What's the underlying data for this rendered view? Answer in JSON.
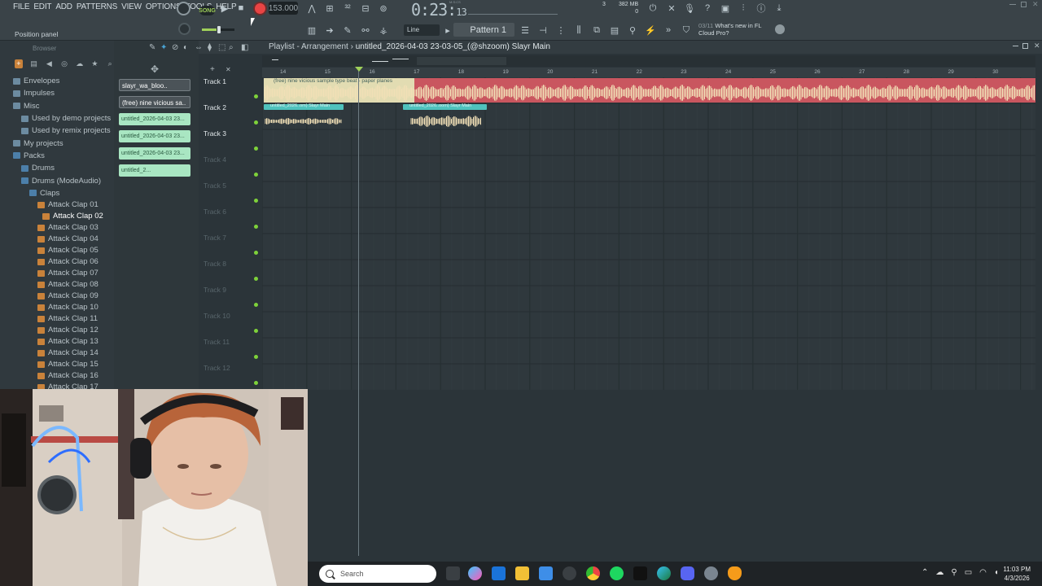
{
  "menu": [
    "FILE",
    "EDIT",
    "ADD",
    "PATTERNS",
    "VIEW",
    "OPTIONS",
    "TOOLS",
    "HELP"
  ],
  "hint": "Position panel",
  "transport": {
    "mode_label": "SONG",
    "tempo": "153.000",
    "time_main": "0:23:",
    "time_sub": "13",
    "time_unit": "M:S:CS"
  },
  "cpu": {
    "value": "3",
    "memory": "382 MB",
    "voices": "0"
  },
  "snap": "Line",
  "pattern": "Pattern 1",
  "news": {
    "date": "03/11",
    "line1": "What's new in FL",
    "line2": "Cloud Pro?"
  },
  "browser": {
    "title": "Browser",
    "items": [
      {
        "label": "Envelopes",
        "indent": 0,
        "icon": "folder"
      },
      {
        "label": "Impulses",
        "indent": 0,
        "icon": "folder"
      },
      {
        "label": "Misc",
        "indent": 0,
        "icon": "folder"
      },
      {
        "label": "Used by demo projects",
        "indent": 1,
        "icon": "folder"
      },
      {
        "label": "Used by remix projects",
        "indent": 1,
        "icon": "folder"
      },
      {
        "label": "My projects",
        "indent": 0,
        "icon": "folder"
      },
      {
        "label": "Packs",
        "indent": 0,
        "icon": "folder-open"
      },
      {
        "label": "Drums",
        "indent": 1,
        "icon": "folder-open"
      },
      {
        "label": "Drums (ModeAudio)",
        "indent": 1,
        "icon": "folder-open"
      },
      {
        "label": "Claps",
        "indent": 2,
        "icon": "folder-open"
      },
      {
        "label": "Attack Clap 01",
        "indent": 3,
        "icon": "audio"
      },
      {
        "label": "Attack Clap 02",
        "indent": 3,
        "icon": "audio",
        "selected": true
      },
      {
        "label": "Attack Clap 03",
        "indent": 3,
        "icon": "audio"
      },
      {
        "label": "Attack Clap 04",
        "indent": 3,
        "icon": "audio"
      },
      {
        "label": "Attack Clap 05",
        "indent": 3,
        "icon": "audio"
      },
      {
        "label": "Attack Clap 06",
        "indent": 3,
        "icon": "audio"
      },
      {
        "label": "Attack Clap 07",
        "indent": 3,
        "icon": "audio"
      },
      {
        "label": "Attack Clap 08",
        "indent": 3,
        "icon": "audio"
      },
      {
        "label": "Attack Clap 09",
        "indent": 3,
        "icon": "audio"
      },
      {
        "label": "Attack Clap 10",
        "indent": 3,
        "icon": "audio"
      },
      {
        "label": "Attack Clap 11",
        "indent": 3,
        "icon": "audio"
      },
      {
        "label": "Attack Clap 12",
        "indent": 3,
        "icon": "audio"
      },
      {
        "label": "Attack Clap 13",
        "indent": 3,
        "icon": "audio"
      },
      {
        "label": "Attack Clap 14",
        "indent": 3,
        "icon": "audio"
      },
      {
        "label": "Attack Clap 15",
        "indent": 3,
        "icon": "audio"
      },
      {
        "label": "Attack Clap 16",
        "indent": 3,
        "icon": "audio"
      },
      {
        "label": "Attack Clap 17",
        "indent": 3,
        "icon": "audio"
      }
    ]
  },
  "clip_list": [
    {
      "label": "slayr_wa_bloo..",
      "style": "dark"
    },
    {
      "label": "(free) nine vicious sa..",
      "style": "dark"
    },
    {
      "label": "untitled_2026-04-03 23...",
      "style": "light"
    },
    {
      "label": "untitled_2026-04-03 23...",
      "style": "light"
    },
    {
      "label": "untitled_2026-04-03 23...",
      "style": "light"
    },
    {
      "label": "untitled_2...",
      "style": "light"
    }
  ],
  "playlist": {
    "title_prefix": "Playlist - Arrangement",
    "title_project": "untitled_2026-04-03 23-03-05_(@shzoom) Slayr Main",
    "ruler": [
      "14",
      "15",
      "16",
      "17",
      "18",
      "19",
      "20",
      "21",
      "22",
      "23",
      "24",
      "25",
      "26",
      "27",
      "28",
      "29",
      "30"
    ],
    "tracks": [
      "Track 1",
      "Track 2",
      "Track 3",
      "Track 4",
      "Track 5",
      "Track 6",
      "Track 7",
      "Track 8",
      "Track 9",
      "Track 10",
      "Track 11",
      "Track 12"
    ],
    "clip1_label": "(free) nine vicious sample type beat - paper planes",
    "clip2_label": "untitled_2026..om) Slayr Main",
    "clip3_label": "untitled_2026..oom) Slayr Main"
  },
  "taskbar": {
    "search_placeholder": "Search",
    "time": "11:03 PM",
    "date": "4/3/2026"
  },
  "colors": {
    "accent_green": "#9fd05a",
    "clip_audio_red": "#d86a72",
    "clip_audio_light": "#f1dfb6",
    "clip_label_teal": "#4fc2bd",
    "record_red": "#e84444"
  }
}
